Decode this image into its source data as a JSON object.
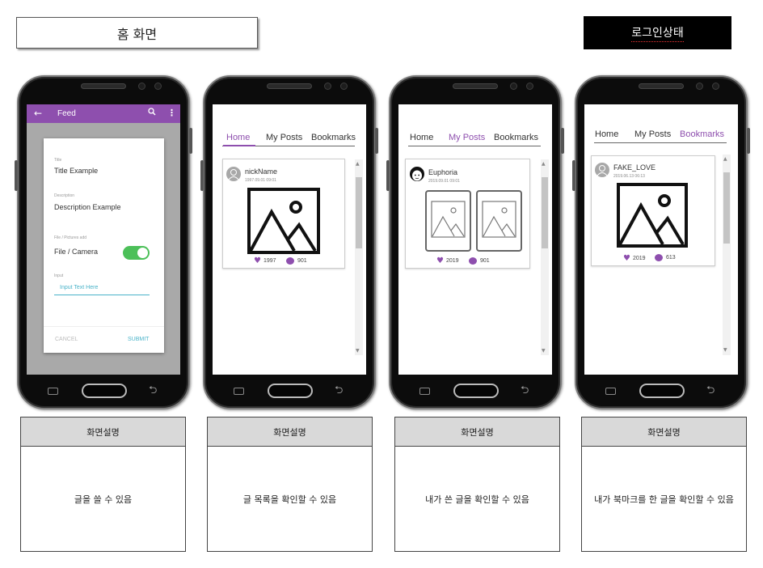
{
  "header": {
    "title": "홈 화면",
    "login_state": "로그인상태"
  },
  "screen1": {
    "app_title": "Feed",
    "back_icon": "arrow-left-icon",
    "search_icon": "search-icon",
    "more_icon": "more-vertical-icon",
    "title_caption": "Title",
    "title_value": "Title Example",
    "description_caption": "Description",
    "description_value": "Description Example",
    "file_caption": "File / Pictures add",
    "file_label": "File / Camera",
    "file_toggle_on": true,
    "input_caption": "Input",
    "input_placeholder": "Input Text Here",
    "cancel_label": "CANCEL",
    "submit_label": "SUBMIT"
  },
  "tabs": [
    "Home",
    "My Posts",
    "Bookmarks"
  ],
  "screen2": {
    "active_tab": "Home",
    "post": {
      "name": "nickName",
      "date": "1997.09.01 09:01",
      "likes": "1997",
      "comments": "901"
    }
  },
  "screen3": {
    "active_tab": "My Posts",
    "post": {
      "name": "Euphoria",
      "date": "2019.09.01 09:01",
      "likes": "2019",
      "comments": "901"
    }
  },
  "screen4": {
    "active_tab": "Bookmarks",
    "post": {
      "name": "FAKE_LOVE",
      "date": "2019.06.13 06:13",
      "likes": "2019",
      "comments": "613"
    }
  },
  "descriptions": [
    {
      "header": "화면설명",
      "text": "글을 쓸 수 있음"
    },
    {
      "header": "화면설명",
      "text": "글 목록을 확인할 수 있음"
    },
    {
      "header": "화면설명",
      "text": "내가 쓴 글을 확인할 수 있음"
    },
    {
      "header": "화면설명",
      "text": "내가 북마크를 한 글을 확인할 수 있음"
    }
  ],
  "colors": {
    "accent": "#8e4fae",
    "toggle": "#4cc059",
    "link": "#4ab3c9"
  }
}
